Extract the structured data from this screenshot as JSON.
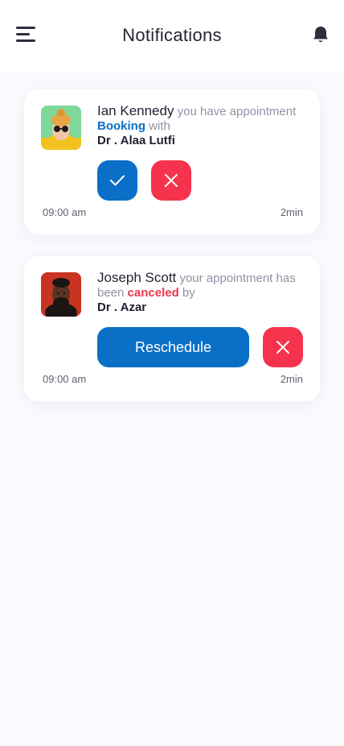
{
  "header": {
    "title": "Notifications"
  },
  "notifications": [
    {
      "name": "Ian Kennedy",
      "text_before": " you have appointment ",
      "accent": "Booking",
      "accent_color": "#0a6fc7",
      "text_after": " with",
      "doctor": "Dr . Alaa Lutfi",
      "time": "09:00 am",
      "ago": "2min",
      "actions": [
        "accept",
        "reject"
      ]
    },
    {
      "name": "Joseph Scott",
      "text_before": " your appointment has been ",
      "accent": "canceled",
      "accent_color": "#f0354c",
      "text_after": " by",
      "doctor": "Dr . Azar",
      "time": "09:00 am",
      "ago": "2min",
      "actions": [
        "reschedule",
        "reject"
      ],
      "reschedule_label": "Reschedule"
    }
  ],
  "colors": {
    "primary": "#0a6fc7",
    "danger": "#f6334c",
    "background": "#f9fafd"
  },
  "icons": [
    "menu-icon",
    "bell-icon",
    "check-icon",
    "close-icon"
  ]
}
